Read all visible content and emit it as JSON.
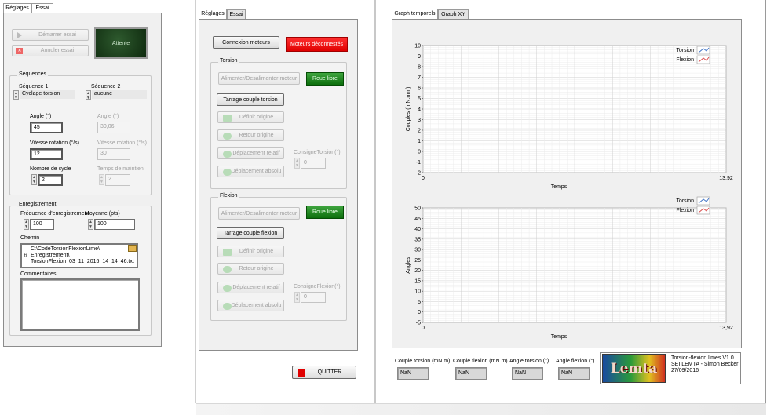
{
  "left": {
    "tabs": [
      "Réglages",
      "Essai"
    ],
    "start_button": "Démarrer essai",
    "cancel_button": "Annuler essai",
    "status_led": "Attente",
    "sequences": {
      "title": "Séquences",
      "seq1_label": "Séquence 1",
      "seq1_value": "Cyclage torsion",
      "seq2_label": "Séquence 2",
      "seq2_value": "aucune"
    },
    "params": {
      "angle_label": "Angle (°)",
      "angle_value": "45",
      "angle2_label": "Angle (°)",
      "angle2_value": "30,06",
      "speed_label": "Vitesse rotation (°/s)",
      "speed_value": "12",
      "speed2_label": "Vitesse rotation (°/s)",
      "speed2_value": "30",
      "cycles_label": "Nombre de cycle",
      "cycles_value": "2",
      "hold_label": "Temps de maintien",
      "hold_value": "2"
    },
    "recording": {
      "title": "Enregistrement",
      "freq_label": "Fréquence d'enregistrement",
      "freq_value": "100",
      "avg_label": "Moyenne (pts)",
      "avg_value": "100",
      "path_label": "Chemin",
      "path_lines": [
        "C:\\CodeTorsionFlexionLime\\",
        "Enregistrement\\",
        "TorsionFlexion_03_11_2016_14_14_46.txt"
      ],
      "comments_label": "Commentaires"
    }
  },
  "mid": {
    "tabs": [
      "Réglages",
      "Essai"
    ],
    "connect_button": "Connexion moteurs",
    "motor_status": "Moteurs déconnestés",
    "torsion": {
      "title": "Torsion",
      "power_button": "Alimenter/Desalimenter moteur",
      "free_button": "Roue libre",
      "tare_button": "Tarrage couple torsion",
      "origin_button": "Définir origine",
      "return_button": "Retour origine",
      "rel_button": "Déplacement relatif",
      "abs_button": "Déplacement absolu",
      "setpoint_label": "ConsigneTorsion(°)",
      "setpoint_value": "0"
    },
    "flexion": {
      "title": "Flexion",
      "power_button": "Alimenter/Desalimenter moteur",
      "free_button": "Roue libre",
      "tare_button": "Tarrage couple flexion",
      "origin_button": "Définir origine",
      "return_button": "Retour origine",
      "rel_button": "Déplacement relatif",
      "abs_button": "Déplacement absolu",
      "setpoint_label": "ConsigneFlexion(°)",
      "setpoint_value": "0"
    },
    "quit_button": "QUITTER"
  },
  "right": {
    "tabs": [
      "Graph temporels",
      "Graph XY"
    ],
    "legend": [
      "Torsion",
      "Flexion"
    ],
    "legend_colors": [
      "#3a6fc4",
      "#d84848"
    ],
    "readouts": [
      {
        "label": "Couple torsion (mN.m)",
        "value": "NaN"
      },
      {
        "label": "Couple flexion (mN.m)",
        "value": "NaN"
      },
      {
        "label": "Angle torsion (°)",
        "value": "NaN"
      },
      {
        "label": "Angle flexion (°)",
        "value": "NaN"
      }
    ],
    "logo_text": "Lemta",
    "info_lines": [
      "Torsion-flexion limes V1.0",
      "SEI LEMTA - Simon Becker",
      "27/09/2016"
    ]
  },
  "chart_data": [
    {
      "type": "line",
      "ylabel": "Couples (mN.mm)",
      "xlabel": "Temps",
      "xlim": [
        0,
        13.92
      ],
      "ylim": [
        -2,
        10
      ],
      "x_ticks": [
        "0",
        "13,92"
      ],
      "y_ticks": [
        "10",
        "9",
        "8",
        "7",
        "6",
        "5",
        "4",
        "3",
        "2",
        "1",
        "0",
        "-1",
        "-2"
      ],
      "series": [
        {
          "name": "Torsion",
          "values": []
        },
        {
          "name": "Flexion",
          "values": []
        }
      ],
      "grid": true,
      "legend": "top-right"
    },
    {
      "type": "line",
      "ylabel": "Angles",
      "xlabel": "Temps",
      "xlim": [
        0,
        13.92
      ],
      "ylim": [
        -5,
        50
      ],
      "x_ticks": [
        "0",
        "13,92"
      ],
      "y_ticks": [
        "50",
        "45",
        "40",
        "35",
        "30",
        "25",
        "20",
        "15",
        "10",
        "5",
        "0",
        "-5"
      ],
      "series": [
        {
          "name": "Torsion",
          "values": []
        },
        {
          "name": "Flexion",
          "values": []
        }
      ],
      "grid": true,
      "legend": "top-right"
    }
  ]
}
